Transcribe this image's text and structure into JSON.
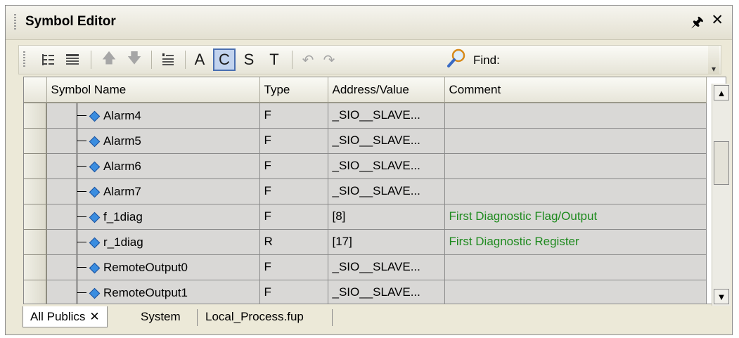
{
  "panel": {
    "title": "Symbol Editor",
    "pin_icon": "pin-icon",
    "close_icon": "close-icon"
  },
  "toolbar": {
    "items": [
      {
        "name": "tree-view-icon"
      },
      {
        "name": "list-view-icon"
      },
      {
        "name": "move-up-icon"
      },
      {
        "name": "move-down-icon"
      },
      {
        "name": "insert-icon"
      },
      {
        "label": "A"
      },
      {
        "label": "C"
      },
      {
        "label": "S"
      },
      {
        "label": "T"
      },
      {
        "name": "undo-icon"
      },
      {
        "name": "redo-icon"
      },
      {
        "name": "search-icon"
      }
    ],
    "find_label": "Find:"
  },
  "table": {
    "columns": [
      "Symbol Name",
      "Type",
      "Address/Value",
      "Comment"
    ],
    "rows": [
      {
        "name": "Alarm4",
        "type": "F",
        "address": "_SIO__SLAVE...",
        "comment": ""
      },
      {
        "name": "Alarm5",
        "type": "F",
        "address": "_SIO__SLAVE...",
        "comment": ""
      },
      {
        "name": "Alarm6",
        "type": "F",
        "address": "_SIO__SLAVE...",
        "comment": ""
      },
      {
        "name": "Alarm7",
        "type": "F",
        "address": "_SIO__SLAVE...",
        "comment": ""
      },
      {
        "name": "f_1diag",
        "type": "F",
        "address": "[8]",
        "comment": "First Diagnostic Flag/Output"
      },
      {
        "name": "r_1diag",
        "type": "R",
        "address": "[17]",
        "comment": "First Diagnostic Register"
      },
      {
        "name": "RemoteOutput0",
        "type": "F",
        "address": "_SIO__SLAVE...",
        "comment": ""
      },
      {
        "name": "RemoteOutput1",
        "type": "F",
        "address": "_SIO__SLAVE...",
        "comment": ""
      }
    ],
    "comment_color": "#1e8a1e"
  },
  "tabs": [
    {
      "label": "All Publics",
      "active": true
    },
    {
      "label": "System",
      "active": false
    },
    {
      "label": "Local_Process.fup",
      "active": false
    }
  ]
}
